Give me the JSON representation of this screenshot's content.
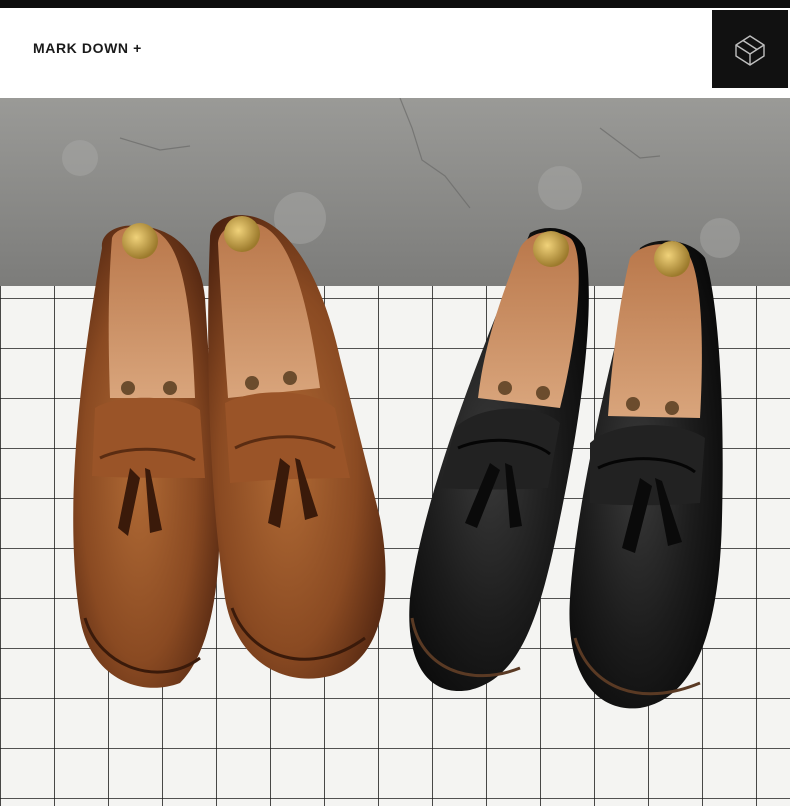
{
  "header": {
    "brand_text": "MARK DOWN +",
    "logo_icon": "cube-logo-icon"
  },
  "photo": {
    "subject": "product-photo",
    "colors": {
      "wall": "#8f8f8c",
      "grid_background": "#f4f4f2",
      "grid_lines": "#1c1c1c",
      "brown_leather": "#8a4a22",
      "black_leather": "#151515",
      "shoe_tree_wood": "#c98f62",
      "shoe_tree_cap": "#c9a64a"
    }
  }
}
